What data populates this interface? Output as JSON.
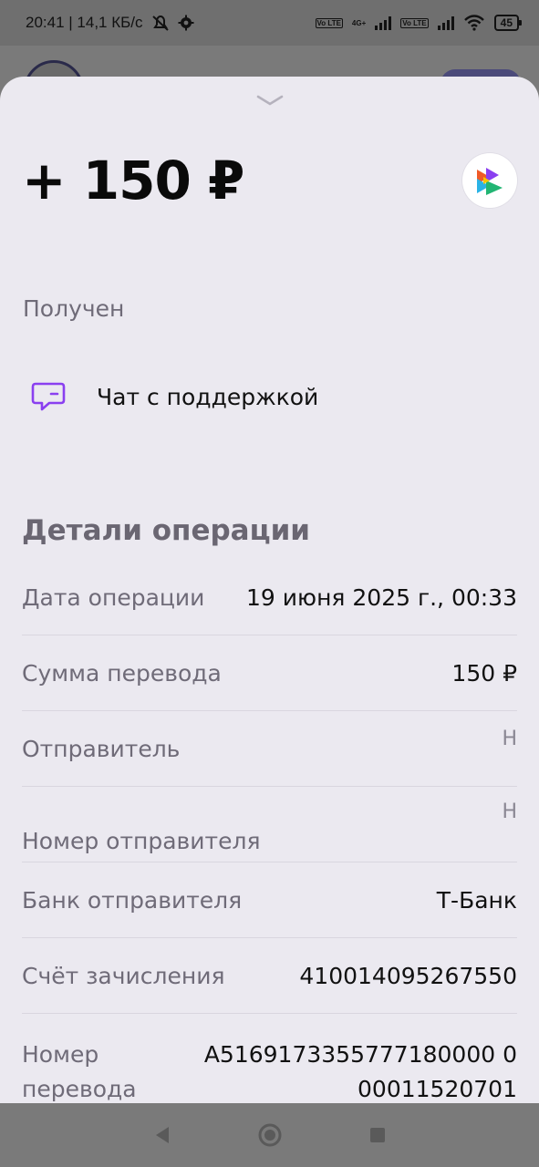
{
  "status_bar": {
    "time_speed": "20:41 | 14,1 КБ/с",
    "lte_1": "Vo LTE",
    "net_label": "4G+",
    "lte_2": "Vo LTE",
    "battery": "45"
  },
  "operation": {
    "amount": "+ 150 ₽",
    "status": "Получен"
  },
  "support": {
    "label": "Чат с поддержкой"
  },
  "details": {
    "title": "Детали операции",
    "rows": [
      {
        "label": "Дата операции",
        "value": "19 июня 2025 г., 00:33"
      },
      {
        "label": "Сумма перевода",
        "value": "150 ₽"
      },
      {
        "label": "Отправитель",
        "value": "Н"
      },
      {
        "label": "Номер отправителя",
        "value": "Н"
      },
      {
        "label": "Банк отправителя",
        "value": "Т-Банк"
      },
      {
        "label": "Счёт зачисления",
        "value": "410014095267550"
      },
      {
        "label": "Номер перевода",
        "value": "A5169173355777180000 000011520701"
      }
    ]
  },
  "colors": {
    "accent": "#8a3ff0",
    "sheet": "#ebe9f0"
  }
}
